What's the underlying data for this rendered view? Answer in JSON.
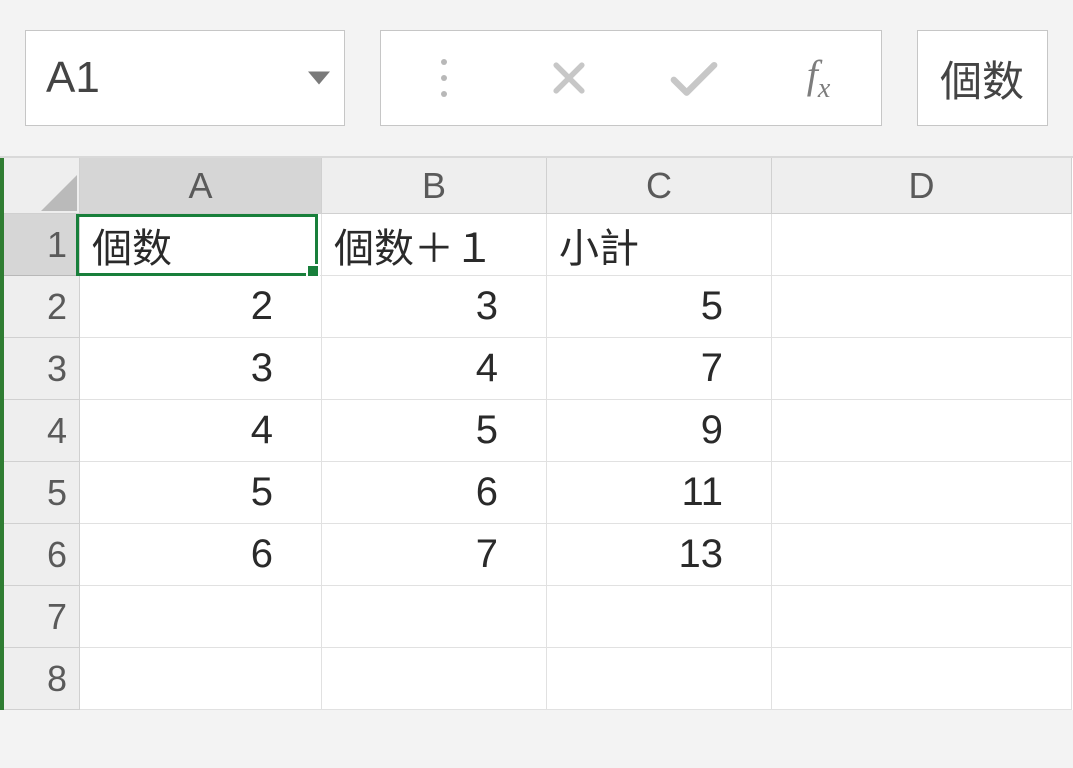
{
  "formula_bar": {
    "name_box": "A1",
    "fx_label": "f",
    "fx_sub": "x",
    "content": "個数"
  },
  "columns": [
    "A",
    "B",
    "C",
    "D"
  ],
  "row_numbers": [
    "1",
    "2",
    "3",
    "4",
    "5",
    "6",
    "7",
    "8"
  ],
  "cells": {
    "r1": {
      "A": "個数",
      "B": "個数＋１",
      "C": "小計",
      "D": ""
    },
    "r2": {
      "A": "2",
      "B": "3",
      "C": "5",
      "D": ""
    },
    "r3": {
      "A": "3",
      "B": "4",
      "C": "7",
      "D": ""
    },
    "r4": {
      "A": "4",
      "B": "5",
      "C": "9",
      "D": ""
    },
    "r5": {
      "A": "5",
      "B": "6",
      "C": "11",
      "D": ""
    },
    "r6": {
      "A": "6",
      "B": "7",
      "C": "13",
      "D": ""
    },
    "r7": {
      "A": "",
      "B": "",
      "C": "",
      "D": ""
    },
    "r8": {
      "A": "",
      "B": "",
      "C": "",
      "D": ""
    }
  },
  "active_cell": "A1"
}
